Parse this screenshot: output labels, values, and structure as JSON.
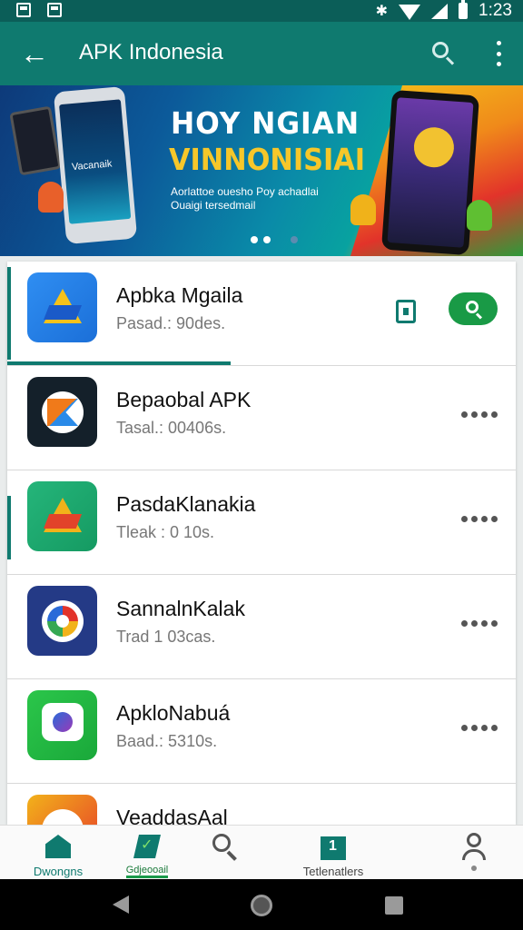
{
  "status_bar": {
    "time": "1:23"
  },
  "app_bar": {
    "title": "APK Indonesia"
  },
  "banner": {
    "title_line1": "HOY NGIAN",
    "title_line2": "VINNONISIAI",
    "subtitle": "Aorlattoe ouesho Poy achadlai Ouaigi tersedmail",
    "phone_text": "Vacanaik"
  },
  "apps": [
    {
      "name": "Apbka Mgaila",
      "meta": "Pasad.: 90des.",
      "icon": "google-drive-icon"
    },
    {
      "name": "Bepaobal APK",
      "meta": "Tasal.: 00406s.",
      "icon": "arrow-logo-icon"
    },
    {
      "name": "PasdaKlanakia",
      "meta": "Tleak : 0 10s.",
      "icon": "google-drive-icon"
    },
    {
      "name": "SannalnKalak",
      "meta": "Trad 1 03cas.",
      "icon": "google-g-icon"
    },
    {
      "name": "ApkloNabuá",
      "meta": "Baad.: 5310s.",
      "icon": "chat-bubble-icon"
    },
    {
      "name": "VeaddasAal",
      "meta": "",
      "icon": "chrome-icon"
    }
  ],
  "bottom_nav": {
    "home": "Dwongns",
    "badge": "Gdjeooail",
    "updates": "Tetlenatlers"
  },
  "colors": {
    "primary": "#0f7a6f",
    "status_bar": "#0b5e58",
    "accent_green": "#199a46"
  }
}
